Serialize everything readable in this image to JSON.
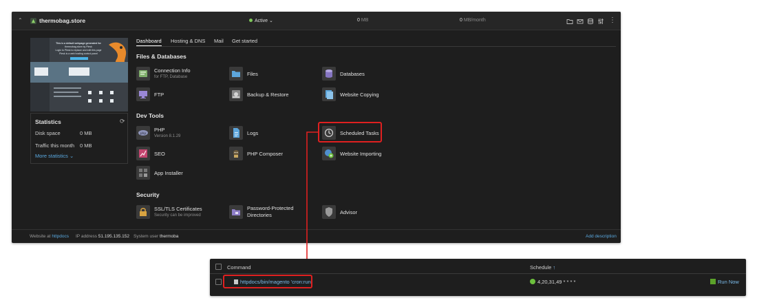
{
  "topbar": {
    "site_name": "thermobag.store",
    "status": "Active",
    "status_caret": "⌄",
    "disk_value": "0",
    "disk_unit": "MB",
    "traffic_value": "0",
    "traffic_unit": "MB/month",
    "icons": [
      "folder-icon",
      "mail-icon",
      "database-icon",
      "settings-sliders-icon",
      "more-vertical-icon"
    ]
  },
  "preview": {
    "line1": "This is a default webpage generated for",
    "line2": "thermobag.store by Plesk",
    "line3": "Login to Plesk to replace and edit this page",
    "line4": "Plesk is a web hosting control panel"
  },
  "stats": {
    "title": "Statistics",
    "disk_label": "Disk space",
    "disk_value": "0 MB",
    "traffic_label": "Traffic this month",
    "traffic_value": "0 MB",
    "more": "More statistics ⌄"
  },
  "tabs": [
    "Dashboard",
    "Hosting & DNS",
    "Mail",
    "Get started"
  ],
  "sections": {
    "files_db": "Files & Databases",
    "dev_tools": "Dev Tools",
    "security": "Security"
  },
  "tools": {
    "connection_info": {
      "name": "Connection Info",
      "sub": "for FTP, Database"
    },
    "files": {
      "name": "Files"
    },
    "databases": {
      "name": "Databases"
    },
    "ftp": {
      "name": "FTP"
    },
    "backup": {
      "name": "Backup & Restore"
    },
    "website_copying": {
      "name": "Website Copying"
    },
    "php": {
      "name": "PHP",
      "sub": "Version 8.1.29"
    },
    "logs": {
      "name": "Logs"
    },
    "scheduled_tasks": {
      "name": "Scheduled Tasks"
    },
    "seo": {
      "name": "SEO"
    },
    "php_composer": {
      "name": "PHP Composer"
    },
    "website_importing": {
      "name": "Website Importing"
    },
    "app_installer": {
      "name": "App Installer"
    },
    "ssl": {
      "name": "SSL/TLS Certificates",
      "sub": "Security can be improved"
    },
    "password_dirs": {
      "name": "Password-Protected",
      "name2": "Directories"
    },
    "advisor": {
      "name": "Advisor"
    }
  },
  "footer": {
    "website_at_label": "Website at",
    "website_at_value": "httpdocs",
    "ip_label": "IP address",
    "ip_value": "51.195.135.152",
    "user_label": "System user",
    "user_value": "thermoba",
    "add_description": "Add description"
  },
  "tasks": {
    "col_command": "Command",
    "col_schedule": "Schedule",
    "sort_arrow": "↑",
    "rows": [
      {
        "command": "httpdocs/bin/magento 'cron:run'",
        "schedule": "4,20,31,49 * * * *",
        "action": "Run Now"
      }
    ]
  },
  "colors": {
    "highlight": "#e02020",
    "link": "#5aa9e0",
    "active_status": "#7ec85a"
  }
}
